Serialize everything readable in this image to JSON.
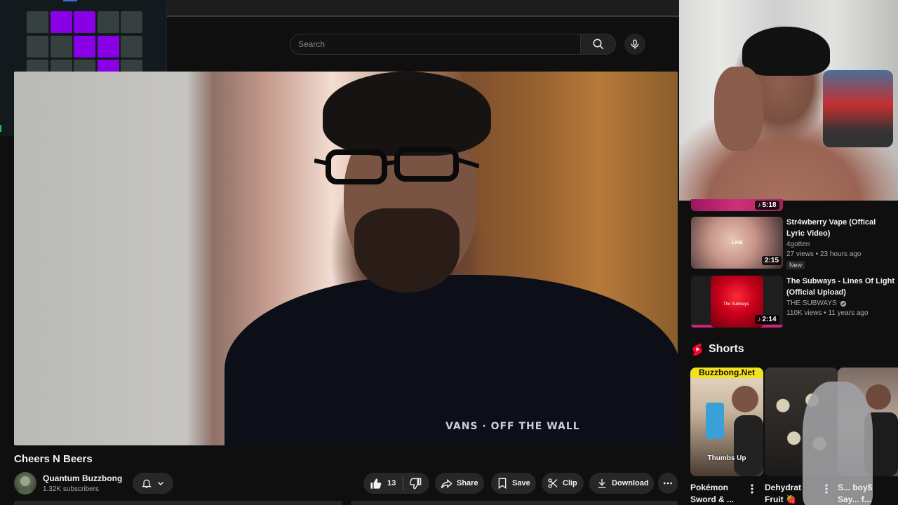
{
  "search": {
    "placeholder": "Search"
  },
  "grid": {
    "rows": 5,
    "cols": 5,
    "on_color": "#8a00e6",
    "off_color": "#35403f",
    "active": [
      [
        0,
        1
      ],
      [
        0,
        2
      ],
      [
        1,
        2
      ],
      [
        1,
        3
      ],
      [
        2,
        3
      ]
    ]
  },
  "video": {
    "title": "Cheers N Beers",
    "shirt_print": "VANS · OFF THE WALL"
  },
  "channel": {
    "name": "Quantum Buzzbong",
    "subscribers": "1.32K subscribers"
  },
  "actions": {
    "like_count": "13",
    "share_label": "Share",
    "save_label": "Save",
    "clip_label": "Clip",
    "download_label": "Download"
  },
  "related": {
    "partial_duration": "5:18",
    "items": [
      {
        "title": "Str4wberry Vape (Offical Lyric Video)",
        "channel": "4gotten",
        "stats": "27 views • 23 hours ago",
        "badge": "New",
        "duration": "2:15",
        "thumb_text": "LIKE"
      },
      {
        "title": "The Subways - Lines Of Light (Official Upload)",
        "channel": "THE SUBWAYS",
        "verified": true,
        "stats": "110K views • 11 years ago",
        "duration": "2:14",
        "thumb_text": "The Subways"
      }
    ]
  },
  "shorts": {
    "heading": "Shorts",
    "items": [
      {
        "title": "Pokémon",
        "title2": "Sword & ...",
        "banner": "Buzzbong.Net",
        "caption": "Thumbs Up"
      },
      {
        "title": "Dehydrat",
        "title2": "Fruit 🍓"
      },
      {
        "title": "S... boy$",
        "title2": "Say... f..."
      }
    ]
  },
  "colors": {
    "background": "#0f0f0f",
    "pill": "#272727",
    "text": "#f1f1f1",
    "secondary_text": "#aaaaaa",
    "shorts_red": "#ff0033"
  }
}
